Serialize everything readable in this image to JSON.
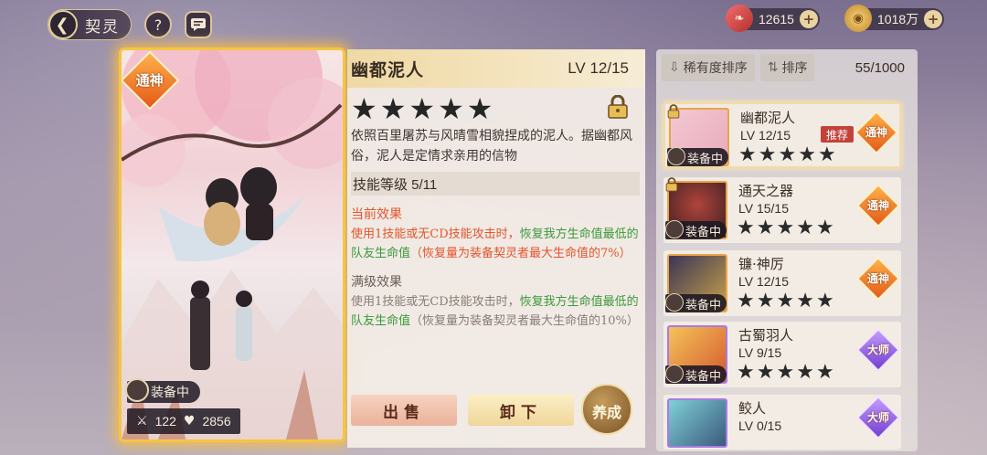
{
  "header": {
    "back_label": "契灵",
    "help_icon": "question-icon",
    "chat_icon": "chat-icon"
  },
  "currency": [
    {
      "icon": "ticket-icon",
      "value": "12615"
    },
    {
      "icon": "coin-icon",
      "value": "1018万"
    }
  ],
  "card": {
    "tag": "通神",
    "equipped_label": "装备中",
    "attack": "122",
    "health": "2856"
  },
  "detail": {
    "name": "幽都泥人",
    "level": "LV 12/15",
    "star_count": 5,
    "description": "依照百里屠苏与风晴雪相貌捏成的泥人。据幽都风俗，泥人是定情求亲用的信物",
    "skill_level": "技能等级 5/11",
    "current_title": "当前效果",
    "current_effect": {
      "part1": "使用1技能或无CD技能攻击时，",
      "part2": "恢复我方生命值最低的队友生命值",
      "part3": "（恢复量为装备契灵者最大生命值的7%）"
    },
    "max_title": "满级效果",
    "max_effect": {
      "part1": "使用1技能或无CD技能攻击时，",
      "part2": "恢复我方生命值最低的队友生命值",
      "part3": "（恢复量为装备契灵者最大生命值的10%）"
    },
    "sell_label": "出售",
    "unload_label": "卸下",
    "nurture_label": "养成"
  },
  "list": {
    "sort_rarity": "稀有度排序",
    "sort_order": "排序",
    "count": "55/1000",
    "items": [
      {
        "name": "幽都泥人",
        "level": "LV 12/15",
        "tag": "通神",
        "equipped": "装备中",
        "recommend": "推荐",
        "locked": true
      },
      {
        "name": "通天之器",
        "level": "LV 15/15",
        "tag": "通神",
        "equipped": "装备中",
        "locked": true
      },
      {
        "name": "镰·神厉",
        "level": "LV 12/15",
        "tag": "通神",
        "equipped": "装备中",
        "locked": false
      },
      {
        "name": "古蜀羽人",
        "level": "LV 9/15",
        "tag": "大师",
        "equipped": "装备中",
        "locked": false
      },
      {
        "name": "鲛人",
        "level": "LV 0/15",
        "tag": "大师",
        "locked": false
      }
    ]
  },
  "colors": {
    "card_glow": "#f5c542",
    "tag_shen": "#e45a18",
    "tag_dashi": "#7140d1",
    "current_effect_red": "#e4552b",
    "heal_green": "#3b9a38"
  }
}
